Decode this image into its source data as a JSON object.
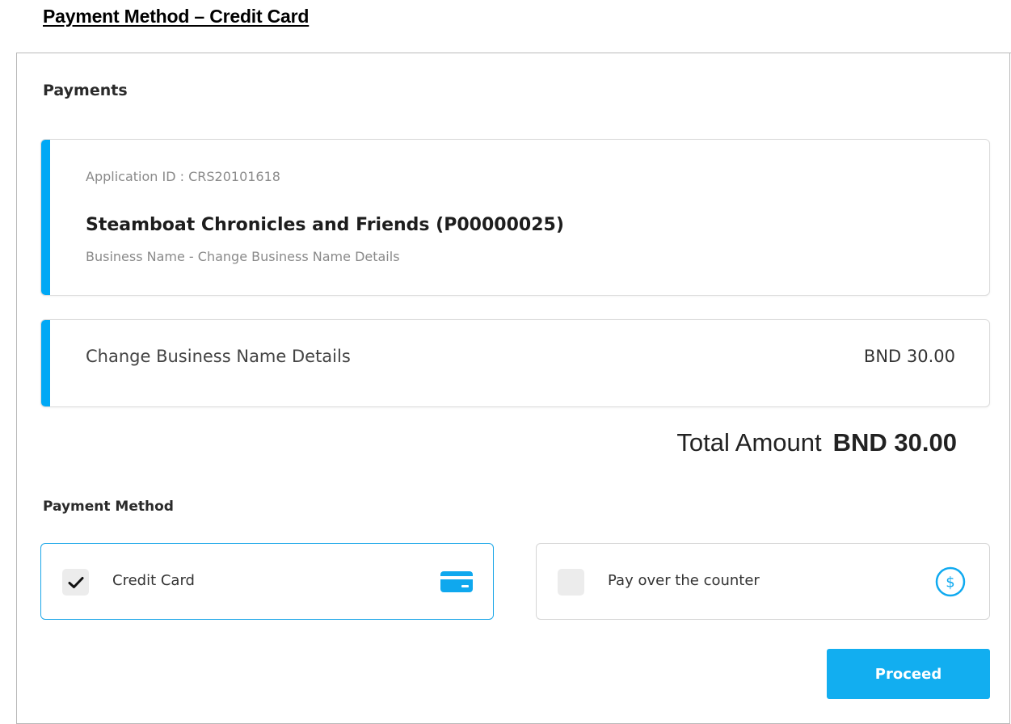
{
  "document": {
    "title": "Payment Method – Credit Card"
  },
  "payments": {
    "heading": "Payments",
    "application": {
      "id_text": "Application ID : CRS20101618",
      "name": "Steamboat Chronicles and Friends (P00000025)",
      "description": "Business Name - Change Business Name Details"
    },
    "line_item": {
      "label": "Change Business Name Details",
      "amount": "BND 30.00"
    },
    "total": {
      "label": "Total Amount",
      "value": "BND 30.00"
    }
  },
  "payment_method": {
    "heading": "Payment Method",
    "options": [
      {
        "label": "Credit Card",
        "selected": true,
        "icon": "credit-card-icon"
      },
      {
        "label": "Pay over the counter",
        "selected": false,
        "icon": "dollar-circle-icon"
      }
    ]
  },
  "actions": {
    "proceed_label": "Proceed"
  },
  "colors": {
    "accent": "#00a8f5",
    "button": "#12aef0",
    "selected_border": "#1aa6e8"
  }
}
